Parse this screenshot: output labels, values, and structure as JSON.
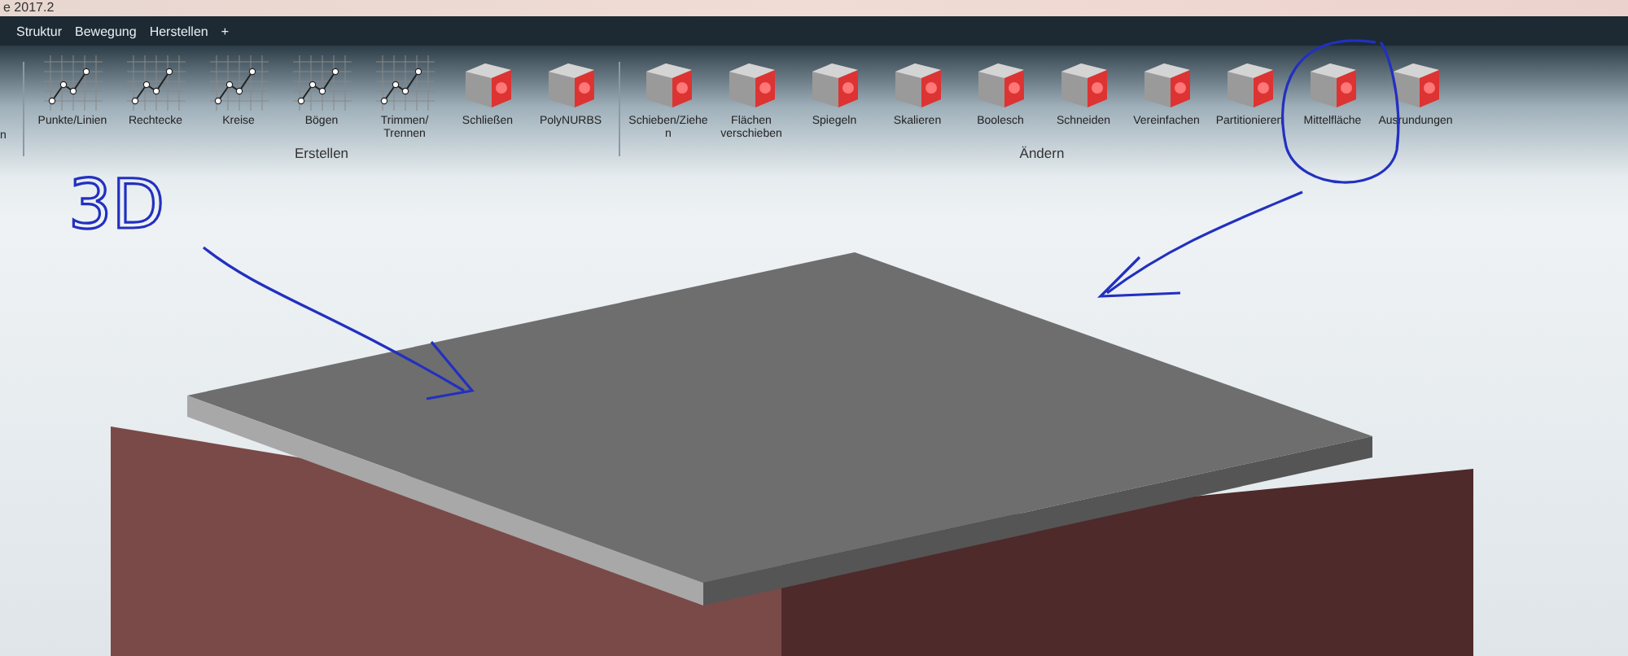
{
  "window": {
    "title": "e 2017.2"
  },
  "menu": [
    {
      "label": "Struktur"
    },
    {
      "label": "Bewegung"
    },
    {
      "label": "Herstellen"
    },
    {
      "label": "+"
    }
  ],
  "toolbar": {
    "cut_item": "n",
    "groups": [
      {
        "label": "Erstellen",
        "items": [
          {
            "label": "Punkte/Linien",
            "kind": "sketch"
          },
          {
            "label": "Rechtecke",
            "kind": "sketch"
          },
          {
            "label": "Kreise",
            "kind": "sketch"
          },
          {
            "label": "Bögen",
            "kind": "sketch"
          },
          {
            "label": "Trimmen/ Trennen",
            "kind": "sketch"
          },
          {
            "label": "Schließen",
            "kind": "solid"
          },
          {
            "label": "PolyNURBS",
            "kind": "solid"
          }
        ]
      },
      {
        "label": "Ändern",
        "items": [
          {
            "label": "Schieben/Ziehe n",
            "kind": "solid"
          },
          {
            "label": "Flächen verschieben",
            "kind": "solid"
          },
          {
            "label": "Spiegeln",
            "kind": "solid"
          },
          {
            "label": "Skalieren",
            "kind": "solid"
          },
          {
            "label": "Boolesch",
            "kind": "solid"
          },
          {
            "label": "Schneiden",
            "kind": "solid"
          },
          {
            "label": "Vereinfachen",
            "kind": "solid"
          },
          {
            "label": "Partitionieren",
            "kind": "solid"
          },
          {
            "label": "Mittelfläche",
            "kind": "solid"
          },
          {
            "label": "Ausrundungen",
            "kind": "solid"
          }
        ]
      }
    ]
  },
  "annotation": {
    "text": "3D"
  }
}
